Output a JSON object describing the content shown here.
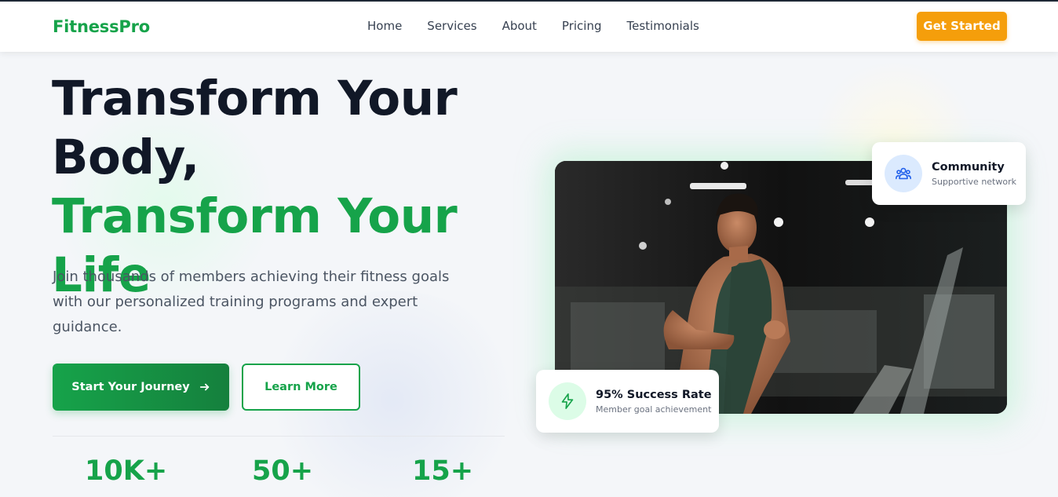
{
  "brand": {
    "name": "FitnessPro",
    "accent": "#16a34a",
    "cta_color": "#f59e0b"
  },
  "nav": {
    "items": [
      {
        "label": "Home"
      },
      {
        "label": "Services"
      },
      {
        "label": "About"
      },
      {
        "label": "Pricing"
      },
      {
        "label": "Testimonials"
      }
    ],
    "cta_label": "Get Started"
  },
  "hero": {
    "title_line1": "Transform Your",
    "title_line2": "Body,",
    "title_line3": "Transform Your Life",
    "subtitle": "Join thousands of members achieving their fitness goals with our personalized training programs and expert guidance.",
    "primary_button": "Start Your Journey",
    "primary_button_icon": "arrow-right-icon",
    "secondary_button": "Learn More"
  },
  "stats": [
    {
      "value": "10K+"
    },
    {
      "value": "50+"
    },
    {
      "value": "15+"
    }
  ],
  "cards": {
    "community": {
      "title": "Community",
      "desc": "Supportive network",
      "icon": "users-icon"
    },
    "success": {
      "title": "95% Success Rate",
      "desc": "Member goal achievement",
      "icon": "lightning-icon"
    }
  }
}
